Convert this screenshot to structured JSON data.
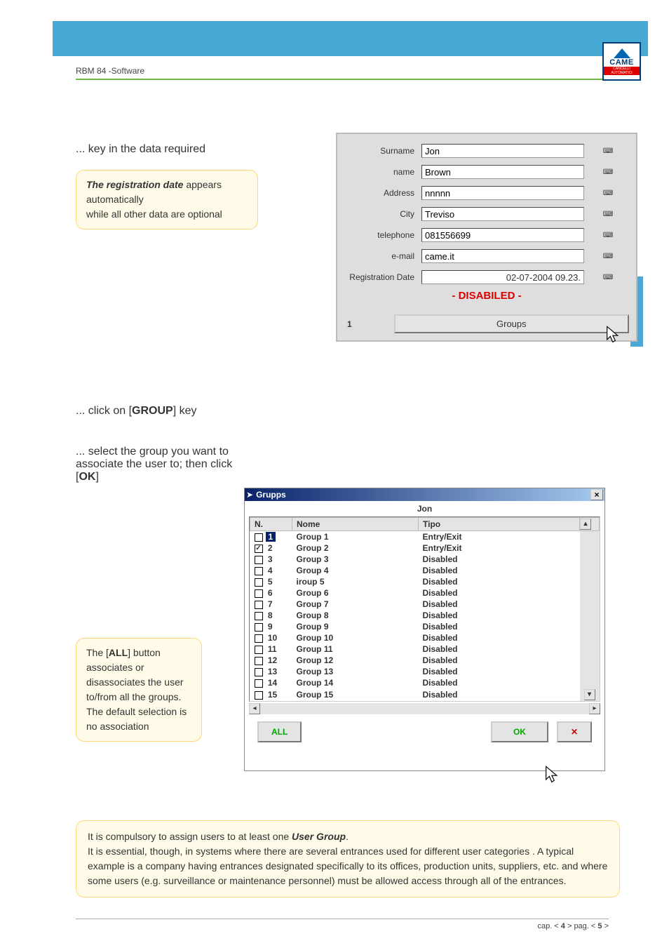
{
  "header": {
    "doc_title": "RBM 84 -Software",
    "logo_text": "CAME",
    "logo_band": "CANCELLI AUTOMATICI"
  },
  "section1": {
    "instr1": "... key in the data required",
    "note1_bold": "The registration date",
    "note1_a": " appears automatically",
    "note1_b": " while all other data are optional",
    "instr2_a": "... click on [",
    "instr2_b": "GROUP",
    "instr2_c": "] key"
  },
  "form": {
    "fields": [
      {
        "label": "Surname",
        "value": "Jon"
      },
      {
        "label": "name",
        "value": "Brown"
      },
      {
        "label": "Address",
        "value": "nnnnn"
      },
      {
        "label": "City",
        "value": "Treviso"
      },
      {
        "label": "telephone",
        "value": "081556699"
      },
      {
        "label": "e-mail",
        "value": "came.it"
      }
    ],
    "reg_label": "Registration Date",
    "reg_value": "02-07-2004 09.23.",
    "disabled": "- DISABILED -",
    "one": "1",
    "groups_btn": "Groups"
  },
  "section2": {
    "instr3_a": "... select the group you want to  associate the user to;  then click [",
    "instr3_b": "OK",
    "instr3_c": "]",
    "note2_a": " The [",
    "note2_b": "ALL",
    "note2_c": "] button associates or disassociates the user to/from all the groups. The default selection is no association"
  },
  "groups_panel": {
    "title": "Grupps",
    "user": "Jon",
    "headers": {
      "n": "N.",
      "nome": "Nome",
      "tipo": "Tipo"
    },
    "rows": [
      {
        "n": "1",
        "nome": "Group  1",
        "tipo": "Entry/Exit",
        "checked": false,
        "selected": true
      },
      {
        "n": "2",
        "nome": "Group  2",
        "tipo": "Entry/Exit",
        "checked": true,
        "selected": false
      },
      {
        "n": "3",
        "nome": "Group  3",
        "tipo": "Disabled",
        "checked": false,
        "selected": false
      },
      {
        "n": "4",
        "nome": "Group  4",
        "tipo": "Disabled",
        "checked": false,
        "selected": false
      },
      {
        "n": "5",
        "nome": "iroup  5",
        "tipo": "Disabled",
        "checked": false,
        "selected": false
      },
      {
        "n": "6",
        "nome": "Group  6",
        "tipo": "Disabled",
        "checked": false,
        "selected": false
      },
      {
        "n": "7",
        "nome": "Group  7",
        "tipo": "Disabled",
        "checked": false,
        "selected": false
      },
      {
        "n": "8",
        "nome": "Group  8",
        "tipo": "Disabled",
        "checked": false,
        "selected": false
      },
      {
        "n": "9",
        "nome": "Group  9",
        "tipo": "Disabled",
        "checked": false,
        "selected": false
      },
      {
        "n": "10",
        "nome": "Group  10",
        "tipo": "Disabled",
        "checked": false,
        "selected": false
      },
      {
        "n": "11",
        "nome": "Group  11",
        "tipo": "Disabled",
        "checked": false,
        "selected": false
      },
      {
        "n": "12",
        "nome": "Group  12",
        "tipo": "Disabled",
        "checked": false,
        "selected": false
      },
      {
        "n": "13",
        "nome": "Group  13",
        "tipo": "Disabled",
        "checked": false,
        "selected": false
      },
      {
        "n": "14",
        "nome": "Group  14",
        "tipo": "Disabled",
        "checked": false,
        "selected": false
      },
      {
        "n": "15",
        "nome": "Group  15",
        "tipo": "Disabled",
        "checked": false,
        "selected": false
      }
    ],
    "all_btn": "ALL",
    "ok_btn": "OK",
    "x_btn": "✕"
  },
  "bottom_note": {
    "a": "It is compulsory to assign users to at least one ",
    "b": "User Group",
    "c": ".",
    "d": "It is essential, though, in systems where there are several entrances used for different user categories . A typical example is a company having entrances designated specifically to its offices, production units, suppliers, etc. and where some users (e.g. surveillance or maintenance personnel) must be allowed access through all of the entrances."
  },
  "footer": {
    "a": "cap. < ",
    "b": "4",
    "c": " > pag. < ",
    "d": "5",
    "e": " >"
  }
}
